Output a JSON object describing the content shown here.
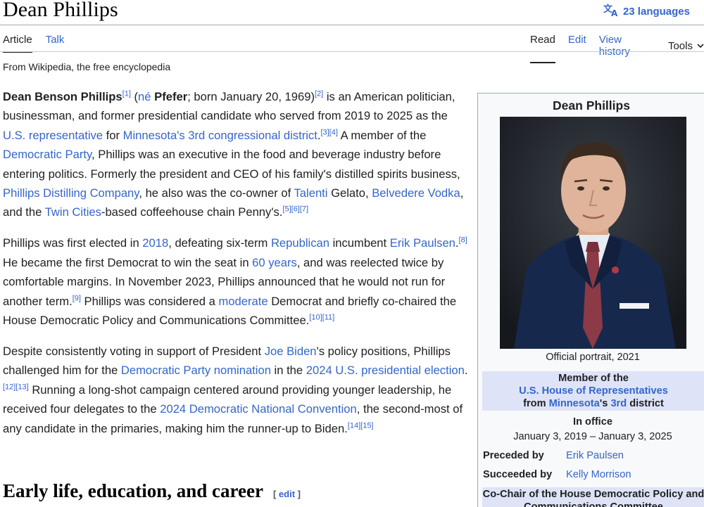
{
  "page": {
    "title": "Dean Phillips",
    "languages": "23 languages",
    "tagline": "From Wikipedia, the free encyclopedia"
  },
  "tabs": {
    "article": "Article",
    "talk": "Talk",
    "read": "Read",
    "edit": "Edit",
    "history": "View history",
    "tools": "Tools"
  },
  "body": {
    "p1": {
      "name": "Dean Benson Phillips",
      "ref1": "[1]",
      "t1": " (",
      "ne": "né",
      "t2": " ",
      "pfefer": "Pfefer",
      "t3": "; born January 20, 1969)",
      "ref2": "[2]",
      "t4": " is an American politician, businessman, and former presidential candidate who served from 2019 to 2025 as the ",
      "l_usrep": "U.S. representative",
      "t5": " for ",
      "l_district": "Minnesota's 3rd congressional district",
      "t6": ".",
      "ref34": "[3][4]",
      "t7": " A member of the ",
      "l_party": "Democratic Party",
      "t8": ", Phillips was an executive in the food and beverage industry before entering politics. Formerly the president and CEO of his family's distilled spirits business, ",
      "l_distilling": "Phillips Distilling Company",
      "t9": ", he also was the co-owner of ",
      "l_talenti": "Talenti",
      "t10": " Gelato, ",
      "l_belvedere": "Belvedere Vodka",
      "t11": ", and the ",
      "l_twin": "Twin Cities",
      "t12": "-based coffeehouse chain Penny's.",
      "ref567": "[5][6][7]"
    },
    "p2": {
      "t1": "Phillips was first elected in ",
      "l_2018": "2018",
      "t2": ", defeating six-term ",
      "l_republican": "Republican",
      "t3": " incumbent ",
      "l_paulsen": "Erik Paulsen",
      "t4": ".",
      "ref8": "[8]",
      "t5": " He became the first Democrat to win the seat in ",
      "l_60": "60 years",
      "t6": ", and was reelected twice by comfortable margins. In November 2023, Phillips announced that he would not run for another term.",
      "ref9": "[9]",
      "t7": " Phillips was considered a ",
      "l_moderate": "moderate",
      "t8": " Democrat and briefly co-chaired the House Democratic Policy and Communications Committee.",
      "ref1011": "[10][11]"
    },
    "p3": {
      "t1": "Despite consistently voting in support of President ",
      "l_biden": "Joe Biden",
      "t2": "'s policy positions, Phillips challenged him for the ",
      "l_nomination": "Democratic Party nomination",
      "t3": " in the ",
      "l_election": "2024 U.S. presidential election",
      "t4": ".",
      "ref1213": "[12][13]",
      "t5": " Running a long-shot campaign centered around providing younger leadership, he received four delegates to the ",
      "l_dnc": "2024 Democratic National Convention",
      "t6": ", the second-most of any candidate in the primaries, making him the runner-up to Biden.",
      "ref1415": "[14][15]"
    },
    "section_heading": "Early life, education, and career",
    "edit_open": "[ ",
    "edit_label": "edit",
    "edit_close": " ]"
  },
  "infobox": {
    "name": "Dean Phillips",
    "caption": "Official portrait, 2021",
    "member_of": "Member of the",
    "house": "U.S. House of Representatives",
    "from": "from ",
    "minnesota": "Minnesota",
    "apos": "'s ",
    "third": "3rd",
    "district": " district",
    "in_office": "In office",
    "dates": "January 3, 2019 – January 3, 2025",
    "preceded_label": "Preceded by",
    "preceded_value": "Erik Paulsen",
    "succeeded_label": "Succeeded by",
    "succeeded_value": "Kelly Morrison",
    "cochair": "Co-Chair of the House Democratic Policy and Communications Committee"
  },
  "colors": {
    "link": "#3366cc",
    "text": "#202122",
    "infobox_band": "#dfe3f7",
    "infobox_bg": "#f8f9fa"
  }
}
